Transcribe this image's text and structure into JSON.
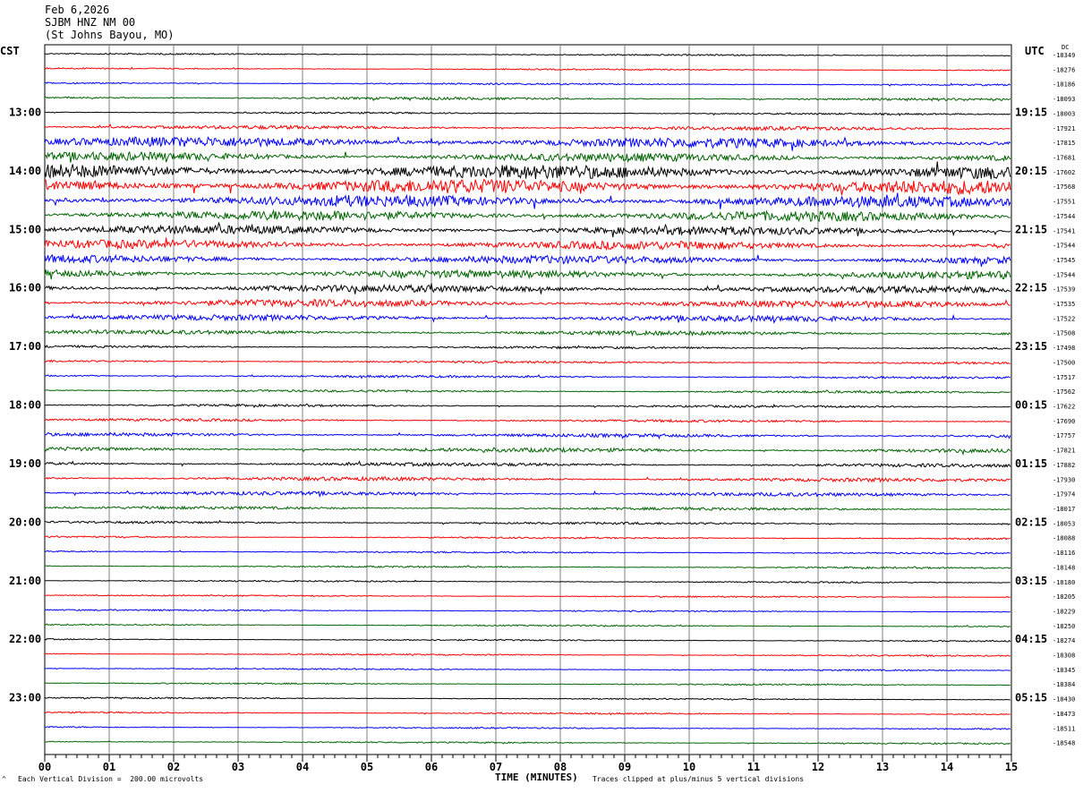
{
  "header": {
    "date": "Feb 6,2026",
    "station": "SJBM HNZ NM 00",
    "location": "(St Johns Bayou, MO)"
  },
  "left_tz": "CST",
  "right_tz": "UTC",
  "dc_label": "DC",
  "footer": {
    "scale_note": "Each Vertical Division =  200.00 microvolts",
    "clip_note": "Traces clipped at plus/minus 5 vertical divisions",
    "corner_mark": "^"
  },
  "colors": {
    "black": "#000000",
    "red": "#ff0000",
    "blue": "#0000ff",
    "green": "#006400",
    "grid": "#808080"
  },
  "chart_data": {
    "type": "line",
    "xlabel": "TIME (MINUTES)",
    "x_ticks": [
      "00",
      "01",
      "02",
      "03",
      "04",
      "05",
      "06",
      "07",
      "08",
      "09",
      "10",
      "11",
      "12",
      "13",
      "14",
      "15"
    ],
    "xlim": [
      0,
      15
    ],
    "left_hour_labels": [
      "13:00",
      "14:00",
      "15:00",
      "16:00",
      "17:00",
      "18:00",
      "19:00",
      "20:00",
      "21:00",
      "22:00",
      "23:00"
    ],
    "right_hour_labels": [
      "19:15",
      "20:15",
      "21:15",
      "22:15",
      "23:15",
      "00:15",
      "01:15",
      "02:15",
      "03:15",
      "04:15",
      "05:15"
    ],
    "trace_colors": [
      "black",
      "red",
      "blue",
      "green"
    ],
    "dc_offsets": [
      -18349,
      -18276,
      -18186,
      -18093,
      -18003,
      -17921,
      -17815,
      -17681,
      -17602,
      -17568,
      -17551,
      -17544,
      -17541,
      -17544,
      -17545,
      -17544,
      -17539,
      -17535,
      -17522,
      -17508,
      -17498,
      -17500,
      -17517,
      -17562,
      -17622,
      -17690,
      -17757,
      -17821,
      -17882,
      -17930,
      -17974,
      -18017,
      -18053,
      -18088,
      -18116,
      -18148,
      -18180,
      -18205,
      -18229,
      -18250,
      -18274,
      -18308,
      -18345,
      -18384,
      -18430,
      -18473,
      -18511,
      -18548
    ],
    "amplitude_per_trace": [
      0.5,
      0.5,
      0.6,
      0.9,
      0.6,
      1.3,
      3.5,
      3.0,
      5.0,
      5.0,
      4.0,
      3.5,
      3.0,
      3.0,
      2.8,
      2.8,
      2.5,
      2.5,
      2.0,
      1.5,
      0.8,
      0.8,
      0.8,
      0.8,
      0.8,
      0.9,
      1.2,
      1.5,
      1.2,
      1.3,
      1.3,
      1.0,
      0.8,
      0.6,
      0.6,
      0.6,
      0.5,
      0.5,
      0.5,
      0.5,
      0.5,
      0.5,
      0.5,
      0.5,
      0.5,
      0.5,
      0.5,
      0.5
    ],
    "clip_divisions": 5
  }
}
